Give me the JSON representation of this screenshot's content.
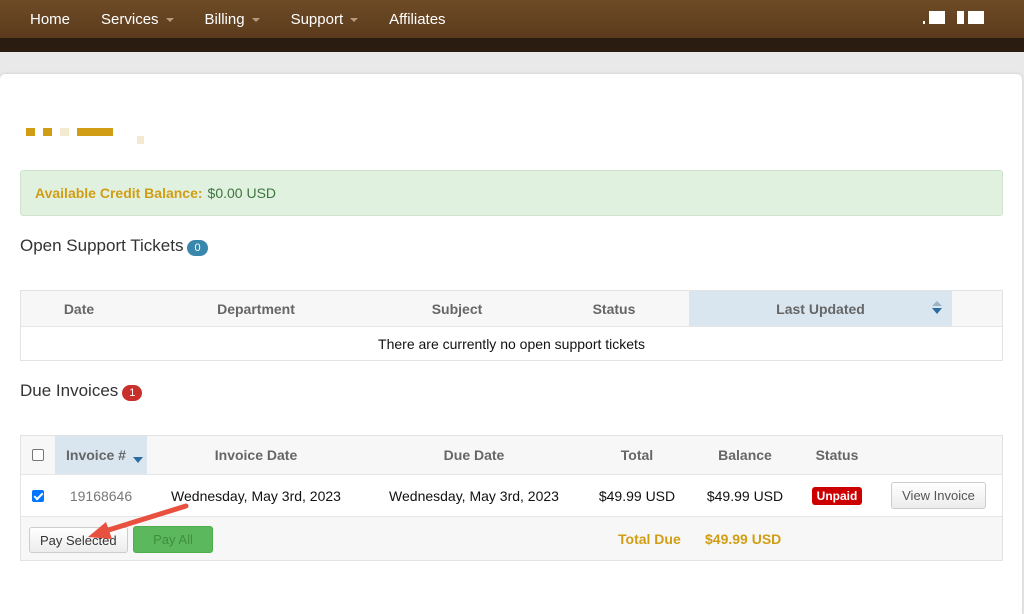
{
  "nav": {
    "items": [
      {
        "label": "Home",
        "dropdown": false
      },
      {
        "label": "Services",
        "dropdown": true
      },
      {
        "label": "Billing",
        "dropdown": true
      },
      {
        "label": "Support",
        "dropdown": true
      },
      {
        "label": "Affiliates",
        "dropdown": false
      }
    ]
  },
  "credit": {
    "label": "Available Credit Balance:",
    "value": "$0.00 USD"
  },
  "tickets": {
    "title": "Open Support Tickets",
    "count": "0",
    "columns": [
      "Date",
      "Department",
      "Subject",
      "Status",
      "Last Updated"
    ],
    "empty_message": "There are currently no open support tickets"
  },
  "invoices": {
    "title": "Due Invoices",
    "count": "1",
    "columns": [
      "Invoice #",
      "Invoice Date",
      "Due Date",
      "Total",
      "Balance",
      "Status"
    ],
    "rows": [
      {
        "selected": true,
        "invoice_no": "19168646",
        "invoice_date": "Wednesday, May 3rd, 2023",
        "due_date": "Wednesday, May 3rd, 2023",
        "total": "$49.99 USD",
        "balance": "$49.99 USD",
        "status": "Unpaid",
        "action_label": "View Invoice"
      }
    ],
    "pay_selected_label": "Pay Selected",
    "pay_all_label": "Pay All",
    "total_due_label": "Total Due",
    "total_due_value": "$49.99 USD"
  },
  "colors": {
    "nav_bg": "#6e4b27",
    "accent_gold": "#d19d14",
    "unpaid_red": "#cc0000",
    "pay_all_green": "#5cb85c",
    "arrow_red": "#e8503f"
  }
}
